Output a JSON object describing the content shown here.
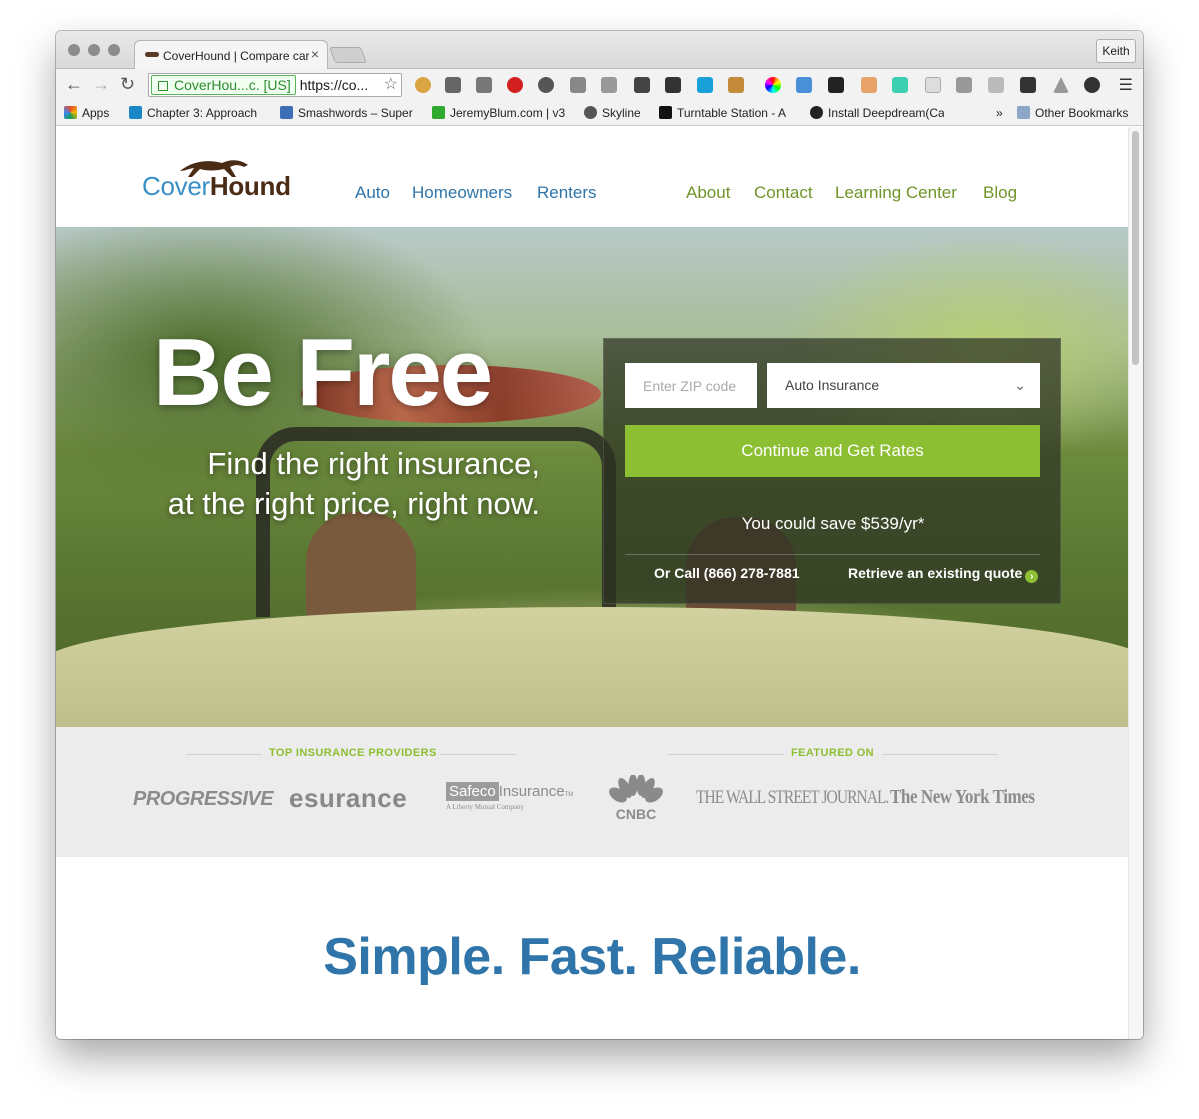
{
  "browser": {
    "tab_title": "CoverHound | Compare car",
    "tab_close": "×",
    "user_button": "Keith",
    "ev_badge": "CoverHou...c. [US]",
    "url": "https://co...",
    "bookmarks": [
      {
        "label": "Apps",
        "color": "#e34c26"
      },
      {
        "label": "Chapter 3: Approach",
        "color": "#1a87c9"
      },
      {
        "label": "Smashwords – Super",
        "color": "#3c6fb5"
      },
      {
        "label": "JeremyBlum.com | v3",
        "color": "#2eaa2e"
      },
      {
        "label": "Skyline",
        "color": "#555555"
      },
      {
        "label": "Turntable Station - A",
        "color": "#111111"
      },
      {
        "label": "Install Deepdream(Ca",
        "color": "#222222"
      }
    ],
    "bookmarks_overflow": "»",
    "other_bookmarks": "Other Bookmarks"
  },
  "site": {
    "logo": {
      "cover": "Cover",
      "hound": "Hound"
    },
    "nav_left": [
      "Auto",
      "Homeowners",
      "Renters"
    ],
    "nav_right": [
      "About",
      "Contact",
      "Learning Center",
      "Blog"
    ],
    "hero": {
      "headline": "Be Free",
      "sub_line1": "Find the right insurance,",
      "sub_line2": "at the right price, right now.",
      "zip_placeholder": "Enter ZIP code",
      "insurance_type": "Auto Insurance",
      "cta": "Continue and Get Rates",
      "savings": "You could save $539/yr*",
      "call": "Or Call (866) 278-7881",
      "retrieve": "Retrieve an existing quote"
    },
    "providers_heading": "TOP INSURANCE PROVIDERS",
    "featured_heading": "FEATURED ON",
    "providers": {
      "progressive": "PROGRESSIVE",
      "esurance": "esurance",
      "safeco_box": "Safeco",
      "safeco_word": "Insurance",
      "safeco_tm": "TM",
      "safeco_sub": "A Liberty Mutual Company"
    },
    "featured": {
      "cnbc": "CNBC",
      "wsj": "THE WALL STREET JOURNAL.",
      "nyt": "The New York Times"
    },
    "tagline": "Simple. Fast. Reliable."
  },
  "colors": {
    "brand_blue": "#2f75a9",
    "brand_green": "#8cbf32",
    "nav_green": "#6f9526",
    "logo_brown": "#4a2c16"
  }
}
